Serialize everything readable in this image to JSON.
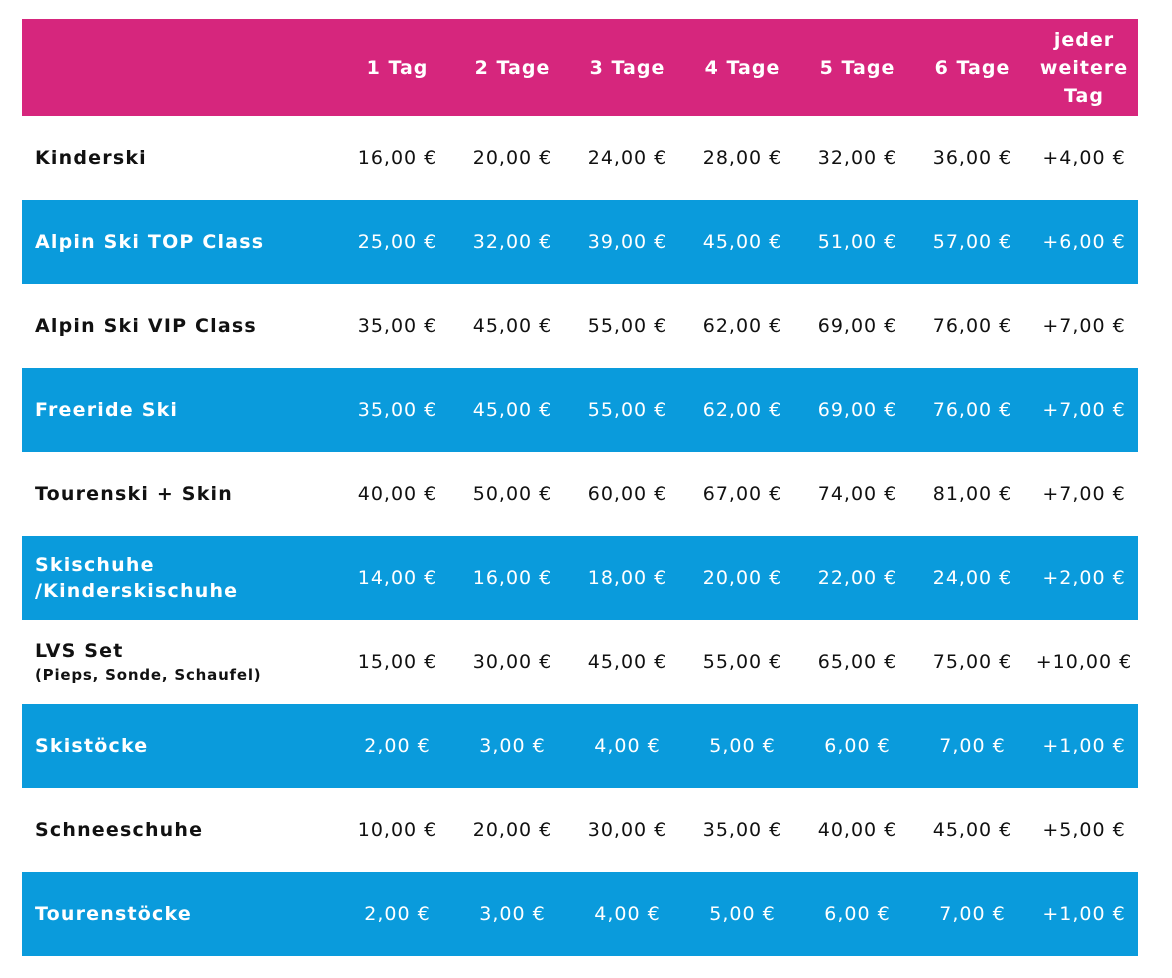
{
  "header": {
    "columns": [
      "1 Tag",
      "2 Tage",
      "3 Tage",
      "4 Tage",
      "5 Tage",
      "6 Tage"
    ],
    "extra_lines": [
      "jeder",
      "weitere",
      "Tag"
    ],
    "colors": {
      "header_bg": "#d6267d",
      "blue_row_bg": "#0a9bdc",
      "white_row_bg": "#ffffff"
    }
  },
  "rows": [
    {
      "name": "Kinderski",
      "sub": "",
      "prices": [
        "16,00 €",
        "20,00 €",
        "24,00 €",
        "28,00 €",
        "32,00 €",
        "36,00 €",
        "+4,00 €"
      ]
    },
    {
      "name": "Alpin Ski TOP Class",
      "sub": "",
      "prices": [
        "25,00 €",
        "32,00 €",
        "39,00 €",
        "45,00 €",
        "51,00 €",
        "57,00 €",
        "+6,00 €"
      ]
    },
    {
      "name": "Alpin Ski VIP Class",
      "sub": "",
      "prices": [
        "35,00 €",
        "45,00 €",
        "55,00 €",
        "62,00 €",
        "69,00 €",
        "76,00 €",
        "+7,00 €"
      ]
    },
    {
      "name": "Freeride Ski",
      "sub": "",
      "prices": [
        "35,00 €",
        "45,00 €",
        "55,00 €",
        "62,00 €",
        "69,00 €",
        "76,00 €",
        "+7,00 €"
      ]
    },
    {
      "name": "Tourenski + Skin",
      "sub": "",
      "prices": [
        "40,00 €",
        "50,00 €",
        "60,00 €",
        "67,00 €",
        "74,00 €",
        "81,00 €",
        "+7,00 €"
      ]
    },
    {
      "name": "Skischuhe /Kinderskischuhe",
      "sub": "",
      "prices": [
        "14,00 €",
        "16,00 €",
        "18,00 €",
        "20,00 €",
        "22,00 €",
        "24,00 €",
        "+2,00 €"
      ]
    },
    {
      "name": "LVS Set",
      "sub": "(Pieps, Sonde, Schaufel)",
      "prices": [
        "15,00 €",
        "30,00 €",
        "45,00 €",
        "55,00 €",
        "65,00 €",
        "75,00 €",
        "+10,00 €"
      ]
    },
    {
      "name": "Skistöcke",
      "sub": "",
      "prices": [
        "2,00 €",
        "3,00 €",
        "4,00 €",
        "5,00 €",
        "6,00 €",
        "7,00 €",
        "+1,00 €"
      ]
    },
    {
      "name": "Schneeschuhe",
      "sub": "",
      "prices": [
        "10,00 €",
        "20,00 €",
        "30,00 €",
        "35,00 €",
        "40,00 €",
        "45,00 €",
        "+5,00 €"
      ]
    },
    {
      "name": "Tourenstöcke",
      "sub": "",
      "prices": [
        "2,00 €",
        "3,00 €",
        "4,00 €",
        "5,00 €",
        "6,00 €",
        "7,00 €",
        "+1,00 €"
      ]
    }
  ]
}
